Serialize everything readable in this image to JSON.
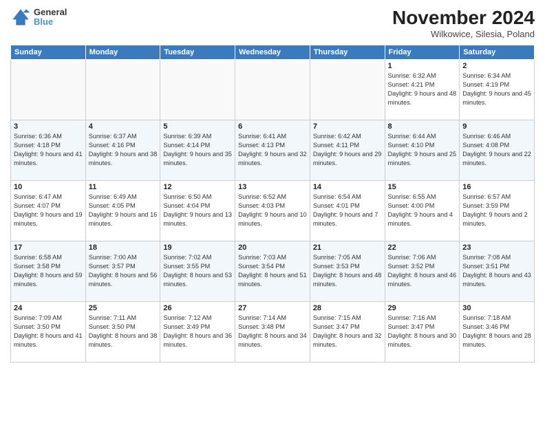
{
  "header": {
    "logo_line1": "General",
    "logo_line2": "Blue",
    "month": "November 2024",
    "location": "Wilkowice, Silesia, Poland"
  },
  "weekdays": [
    "Sunday",
    "Monday",
    "Tuesday",
    "Wednesday",
    "Thursday",
    "Friday",
    "Saturday"
  ],
  "weeks": [
    [
      {
        "day": "",
        "info": ""
      },
      {
        "day": "",
        "info": ""
      },
      {
        "day": "",
        "info": ""
      },
      {
        "day": "",
        "info": ""
      },
      {
        "day": "",
        "info": ""
      },
      {
        "day": "1",
        "info": "Sunrise: 6:32 AM\nSunset: 4:21 PM\nDaylight: 9 hours and 48 minutes."
      },
      {
        "day": "2",
        "info": "Sunrise: 6:34 AM\nSunset: 4:19 PM\nDaylight: 9 hours and 45 minutes."
      }
    ],
    [
      {
        "day": "3",
        "info": "Sunrise: 6:36 AM\nSunset: 4:18 PM\nDaylight: 9 hours and 41 minutes."
      },
      {
        "day": "4",
        "info": "Sunrise: 6:37 AM\nSunset: 4:16 PM\nDaylight: 9 hours and 38 minutes."
      },
      {
        "day": "5",
        "info": "Sunrise: 6:39 AM\nSunset: 4:14 PM\nDaylight: 9 hours and 35 minutes."
      },
      {
        "day": "6",
        "info": "Sunrise: 6:41 AM\nSunset: 4:13 PM\nDaylight: 9 hours and 32 minutes."
      },
      {
        "day": "7",
        "info": "Sunrise: 6:42 AM\nSunset: 4:11 PM\nDaylight: 9 hours and 29 minutes."
      },
      {
        "day": "8",
        "info": "Sunrise: 6:44 AM\nSunset: 4:10 PM\nDaylight: 9 hours and 25 minutes."
      },
      {
        "day": "9",
        "info": "Sunrise: 6:46 AM\nSunset: 4:08 PM\nDaylight: 9 hours and 22 minutes."
      }
    ],
    [
      {
        "day": "10",
        "info": "Sunrise: 6:47 AM\nSunset: 4:07 PM\nDaylight: 9 hours and 19 minutes."
      },
      {
        "day": "11",
        "info": "Sunrise: 6:49 AM\nSunset: 4:05 PM\nDaylight: 9 hours and 16 minutes."
      },
      {
        "day": "12",
        "info": "Sunrise: 6:50 AM\nSunset: 4:04 PM\nDaylight: 9 hours and 13 minutes."
      },
      {
        "day": "13",
        "info": "Sunrise: 6:52 AM\nSunset: 4:03 PM\nDaylight: 9 hours and 10 minutes."
      },
      {
        "day": "14",
        "info": "Sunrise: 6:54 AM\nSunset: 4:01 PM\nDaylight: 9 hours and 7 minutes."
      },
      {
        "day": "15",
        "info": "Sunrise: 6:55 AM\nSunset: 4:00 PM\nDaylight: 9 hours and 4 minutes."
      },
      {
        "day": "16",
        "info": "Sunrise: 6:57 AM\nSunset: 3:59 PM\nDaylight: 9 hours and 2 minutes."
      }
    ],
    [
      {
        "day": "17",
        "info": "Sunrise: 6:58 AM\nSunset: 3:58 PM\nDaylight: 8 hours and 59 minutes."
      },
      {
        "day": "18",
        "info": "Sunrise: 7:00 AM\nSunset: 3:57 PM\nDaylight: 8 hours and 56 minutes."
      },
      {
        "day": "19",
        "info": "Sunrise: 7:02 AM\nSunset: 3:55 PM\nDaylight: 8 hours and 53 minutes."
      },
      {
        "day": "20",
        "info": "Sunrise: 7:03 AM\nSunset: 3:54 PM\nDaylight: 8 hours and 51 minutes."
      },
      {
        "day": "21",
        "info": "Sunrise: 7:05 AM\nSunset: 3:53 PM\nDaylight: 8 hours and 48 minutes."
      },
      {
        "day": "22",
        "info": "Sunrise: 7:06 AM\nSunset: 3:52 PM\nDaylight: 8 hours and 46 minutes."
      },
      {
        "day": "23",
        "info": "Sunrise: 7:08 AM\nSunset: 3:51 PM\nDaylight: 8 hours and 43 minutes."
      }
    ],
    [
      {
        "day": "24",
        "info": "Sunrise: 7:09 AM\nSunset: 3:50 PM\nDaylight: 8 hours and 41 minutes."
      },
      {
        "day": "25",
        "info": "Sunrise: 7:11 AM\nSunset: 3:50 PM\nDaylight: 8 hours and 38 minutes."
      },
      {
        "day": "26",
        "info": "Sunrise: 7:12 AM\nSunset: 3:49 PM\nDaylight: 8 hours and 36 minutes."
      },
      {
        "day": "27",
        "info": "Sunrise: 7:14 AM\nSunset: 3:48 PM\nDaylight: 8 hours and 34 minutes."
      },
      {
        "day": "28",
        "info": "Sunrise: 7:15 AM\nSunset: 3:47 PM\nDaylight: 8 hours and 32 minutes."
      },
      {
        "day": "29",
        "info": "Sunrise: 7:16 AM\nSunset: 3:47 PM\nDaylight: 8 hours and 30 minutes."
      },
      {
        "day": "30",
        "info": "Sunrise: 7:18 AM\nSunset: 3:46 PM\nDaylight: 8 hours and 28 minutes."
      }
    ]
  ]
}
